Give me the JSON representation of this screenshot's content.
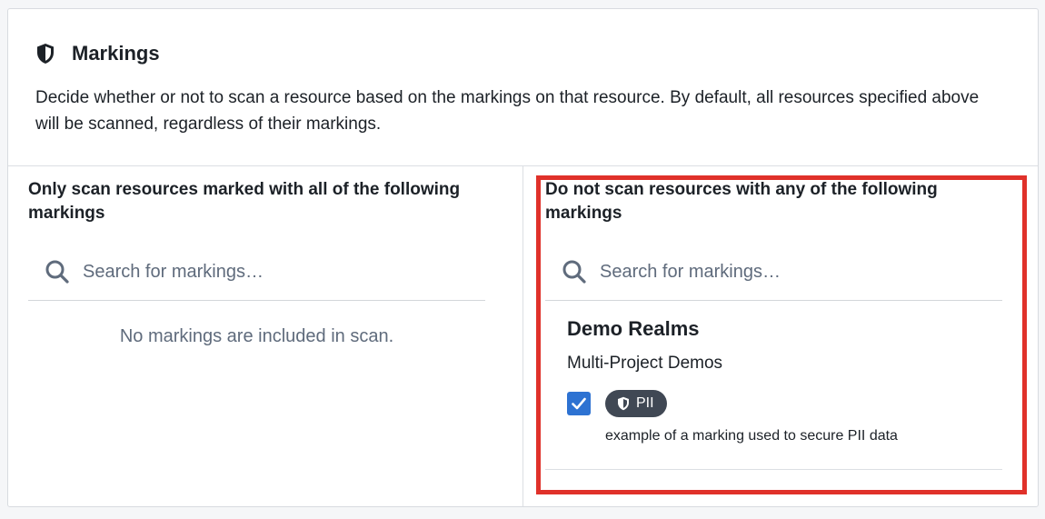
{
  "header": {
    "icon": "shield-icon",
    "title": "Markings",
    "description": "Decide whether or not to scan a resource based on the markings on that resource. By default, all resources specified above will be scanned, regardless of their markings."
  },
  "include_panel": {
    "title": "Only scan resources marked with all of the following markings",
    "search_placeholder": "Search for markings…",
    "empty_message": "No markings are included in scan."
  },
  "exclude_panel": {
    "title": "Do not scan resources with any of the following markings",
    "search_placeholder": "Search for markings…",
    "groups": [
      {
        "name": "Demo Realms",
        "subgroup": "Multi-Project Demos",
        "markings": [
          {
            "label": "PII",
            "checked": true,
            "description": "example of a marking used to secure PII data"
          }
        ]
      }
    ]
  },
  "colors": {
    "accent": "#2d72d2",
    "tag_bg": "#404854",
    "highlight": "#e0312a"
  }
}
